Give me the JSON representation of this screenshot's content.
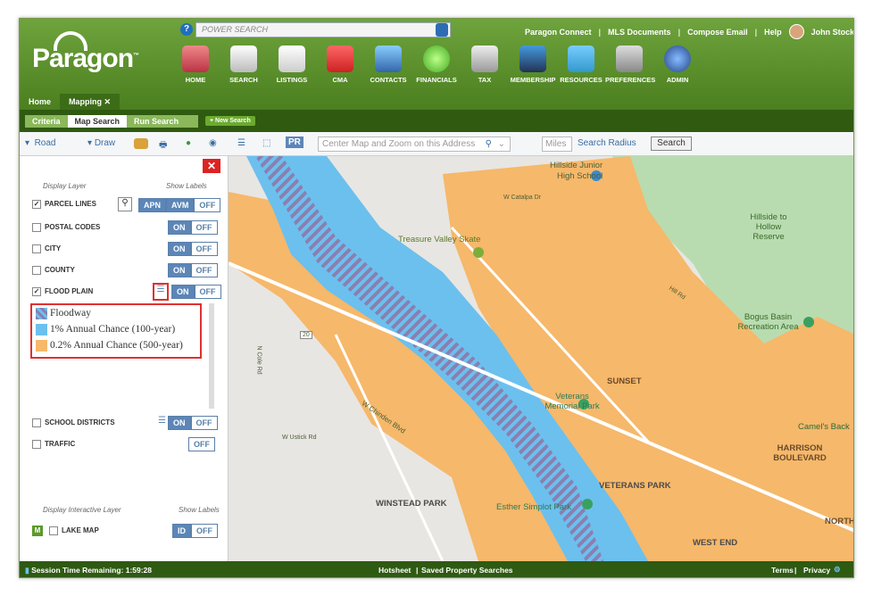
{
  "header": {
    "search_placeholder": "POWER SEARCH",
    "links": [
      "Paragon Connect",
      "MLS Documents",
      "Compose Email",
      "Help"
    ],
    "user_name": "John Stock",
    "logo_text": "Paragon",
    "nav": [
      "HOME",
      "SEARCH",
      "LISTINGS",
      "CMA",
      "CONTACTS",
      "FINANCIALS",
      "TAX",
      "MEMBERSHIP",
      "RESOURCES",
      "PREFERENCES",
      "ADMIN"
    ],
    "tabs": [
      "Home",
      "Mapping"
    ]
  },
  "subtabs": [
    "Criteria",
    "Map Search",
    "Run Search"
  ],
  "new_search": "+ New Search",
  "toolbar": {
    "road": "Road",
    "draw": "Draw",
    "pr": "PR",
    "address_placeholder": "Center Map and Zoom on this Address",
    "miles_placeholder": "Miles",
    "radius": "Search Radius",
    "search": "Search"
  },
  "panel": {
    "display_layer": "Display Layer",
    "show_labels": "Show Labels",
    "layers": [
      {
        "name": "PARCEL LINES",
        "checked": true
      },
      {
        "name": "POSTAL CODES",
        "checked": false
      },
      {
        "name": "CITY",
        "checked": false
      },
      {
        "name": "COUNTY",
        "checked": false
      },
      {
        "name": "FLOOD PLAIN",
        "checked": true
      },
      {
        "name": "SCHOOL DISTRICTS",
        "checked": false
      },
      {
        "name": "TRAFFIC",
        "checked": false
      }
    ],
    "apn": "APN",
    "avm": "AVM",
    "on": "ON",
    "off": "OFF",
    "legend": [
      "Floodway",
      "1% Annual Chance (100-year)",
      "0.2% Annual Chance (500-year)"
    ],
    "interactive_layer": "Display Interactive Layer",
    "show_labels2": "Show Labels",
    "lake_map": "LAKE MAP",
    "m": "M",
    "id": "ID"
  },
  "map_labels": {
    "hillside_junior": "Hillside Junior",
    "high_school": "High School",
    "calalpa": "W Catalpa Dr",
    "treasure": "Treasure Valley Skate",
    "hillside_reserve": "Hillside to Hollow Reserve",
    "bogus": "Bogus Basin Recreation Area",
    "veterans": "Veterans Memorial Park",
    "sunset": "SUNSET",
    "camels": "Camel's Back",
    "harrison": "HARRISON BOULEVARD",
    "veterans_park": "VETERANS PARK",
    "winstead": "WINSTEAD PARK",
    "esther": "Esther Simplot Park",
    "north": "NORTH",
    "west_end": "WEST END",
    "chinden": "W Chinden Blvd",
    "hill_rd": "Hill Rd",
    "ustick": "W Ustick Rd",
    "n_cole": "N Cole Rd",
    "hwy20": "20"
  },
  "footer": {
    "session": "Session Time Remaining: 1:59:28",
    "hotsheet": "Hotsheet",
    "saved": "Saved Property Searches",
    "terms": "Terms",
    "privacy": "Privacy"
  },
  "colors": {
    "floodway": "#8a7fb0",
    "hundred": "#6cc0ee",
    "fivehundred": "#f6b86a"
  }
}
